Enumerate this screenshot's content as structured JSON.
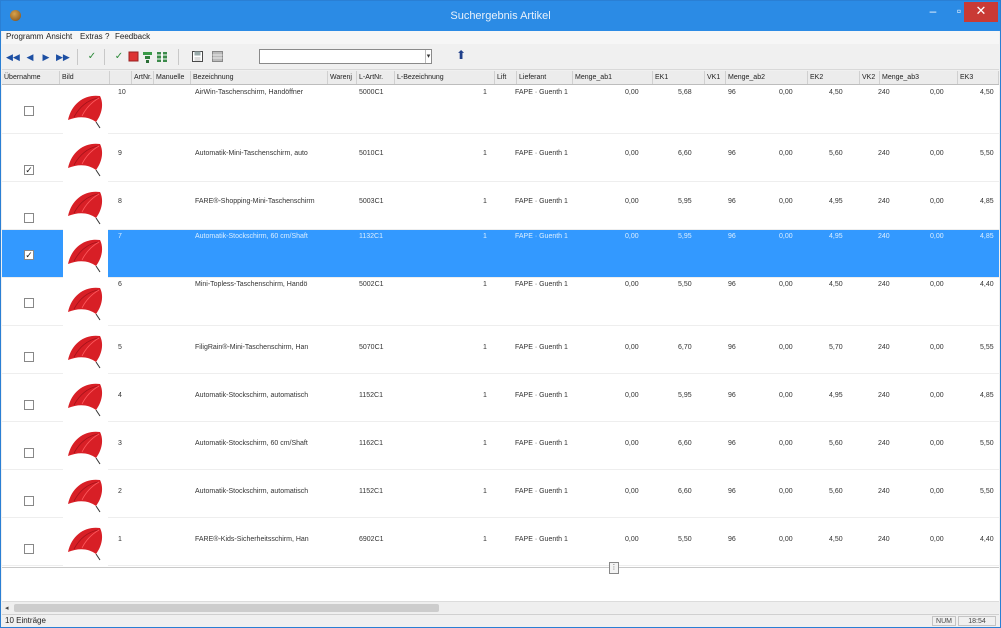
{
  "window": {
    "title": "Suchergebnis Artikel",
    "min": "–",
    "max": "▫",
    "close": "✕"
  },
  "menu": [
    "Programm",
    "Ansicht",
    "Extras",
    "?",
    "Feedback"
  ],
  "toolbar": {
    "nav": [
      "◀◀",
      "◀",
      "▶",
      "▶▶"
    ],
    "search_value": "",
    "search_dropdown": "▾",
    "up_label": "⬆"
  },
  "columns": [
    "Übernahme",
    "Bild",
    "",
    "ArtNr.",
    "Manuelle",
    "Bezeichnung",
    "Warenj",
    "L-ArtNr.",
    "L-Bezeichnung",
    "Lift",
    "Lieferant",
    "Menge_ab1",
    "EK1",
    "VK1",
    "Menge_ab2",
    "EK2",
    "VK2",
    "Menge_ab3",
    "EK3"
  ],
  "rows": [
    {
      "checked": false,
      "selected": false,
      "nr": "10",
      "desc": "AirWin-Taschenschirm, Handöffner",
      "lartnr": "5000C1",
      "lift": "1",
      "supplier": "FAPE · Guenth 1",
      "m1": "0,00",
      "ek1": "5,68",
      "vk1": "96",
      "m2": "0,00",
      "ek2": "4,50",
      "vk2": "240",
      "m3": "0,00",
      "ek3": "4,50"
    },
    {
      "checked": true,
      "selected": false,
      "nr": "9",
      "desc": "Automatik-Mini-Taschenschirm, auto",
      "lartnr": "5010C1",
      "lift": "1",
      "supplier": "FAPE · Guenth 1",
      "m1": "0,00",
      "ek1": "6,60",
      "vk1": "96",
      "m2": "0,00",
      "ek2": "5,60",
      "vk2": "240",
      "m3": "0,00",
      "ek3": "5,50"
    },
    {
      "checked": false,
      "selected": false,
      "nr": "8",
      "desc": "FARE®-Shopping-Mini-Taschenschirm",
      "lartnr": "5003C1",
      "lift": "1",
      "supplier": "FAPE · Guenth 1",
      "m1": "0,00",
      "ek1": "5,95",
      "vk1": "96",
      "m2": "0,00",
      "ek2": "4,95",
      "vk2": "240",
      "m3": "0,00",
      "ek3": "4,85"
    },
    {
      "checked": true,
      "selected": true,
      "nr": "7",
      "desc": "Automatik-Stockschirm, 60 cm/Shaft",
      "lartnr": "1132C1",
      "lift": "1",
      "supplier": "FAPE · Guenth 1",
      "m1": "0,00",
      "ek1": "5,95",
      "vk1": "96",
      "m2": "0,00",
      "ek2": "4,95",
      "vk2": "240",
      "m3": "0,00",
      "ek3": "4,85"
    },
    {
      "checked": false,
      "selected": false,
      "nr": "6",
      "desc": "Mini-Topless-Taschenschirm, Handö",
      "lartnr": "5002C1",
      "lift": "1",
      "supplier": "FAPE · Guenth 1",
      "m1": "0,00",
      "ek1": "5,50",
      "vk1": "96",
      "m2": "0,00",
      "ek2": "4,50",
      "vk2": "240",
      "m3": "0,00",
      "ek3": "4,40"
    },
    {
      "checked": false,
      "selected": false,
      "nr": "5",
      "desc": "FiligRain®-Mini-Taschenschirm, Han",
      "lartnr": "5070C1",
      "lift": "1",
      "supplier": "FAPE · Guenth 1",
      "m1": "0,00",
      "ek1": "6,70",
      "vk1": "96",
      "m2": "0,00",
      "ek2": "5,70",
      "vk2": "240",
      "m3": "0,00",
      "ek3": "5,55"
    },
    {
      "checked": false,
      "selected": false,
      "nr": "4",
      "desc": "Automatik-Stockschirm, automatisch",
      "lartnr": "1152C1",
      "lift": "1",
      "supplier": "FAPE · Guenth 1",
      "m1": "0,00",
      "ek1": "5,95",
      "vk1": "96",
      "m2": "0,00",
      "ek2": "4,95",
      "vk2": "240",
      "m3": "0,00",
      "ek3": "4,85"
    },
    {
      "checked": false,
      "selected": false,
      "nr": "3",
      "desc": "Automatik-Stockschirm, 60 cm/Shaft",
      "lartnr": "1162C1",
      "lift": "1",
      "supplier": "FAPE · Guenth 1",
      "m1": "0,00",
      "ek1": "6,60",
      "vk1": "96",
      "m2": "0,00",
      "ek2": "5,60",
      "vk2": "240",
      "m3": "0,00",
      "ek3": "5,50"
    },
    {
      "checked": false,
      "selected": false,
      "nr": "2",
      "desc": "Automatik-Stockschirm, automatisch",
      "lartnr": "1152C1",
      "lift": "1",
      "supplier": "FAPE · Guenth 1",
      "m1": "0,00",
      "ek1": "6,60",
      "vk1": "96",
      "m2": "0,00",
      "ek2": "5,60",
      "vk2": "240",
      "m3": "0,00",
      "ek3": "5,50"
    },
    {
      "checked": false,
      "selected": false,
      "nr": "1",
      "desc": "FARE®-Kids-Sicherheitsschirm, Han",
      "lartnr": "6902C1",
      "lift": "1",
      "supplier": "FAPE · Guenth 1",
      "m1": "0,00",
      "ek1": "5,50",
      "vk1": "96",
      "m2": "0,00",
      "ek2": "4,50",
      "vk2": "240",
      "m3": "0,00",
      "ek3": "4,40"
    }
  ],
  "checkmark": "✓",
  "splitter": "⋮",
  "scroll_left": "◂",
  "status": {
    "left": "10 Einträge",
    "box1": "NUM",
    "box2": "18:54"
  },
  "colors": {
    "titlebar": "#2b8be5",
    "selection": "#3399ff",
    "umbrella": "#d81f26",
    "close": "#c93a35"
  }
}
